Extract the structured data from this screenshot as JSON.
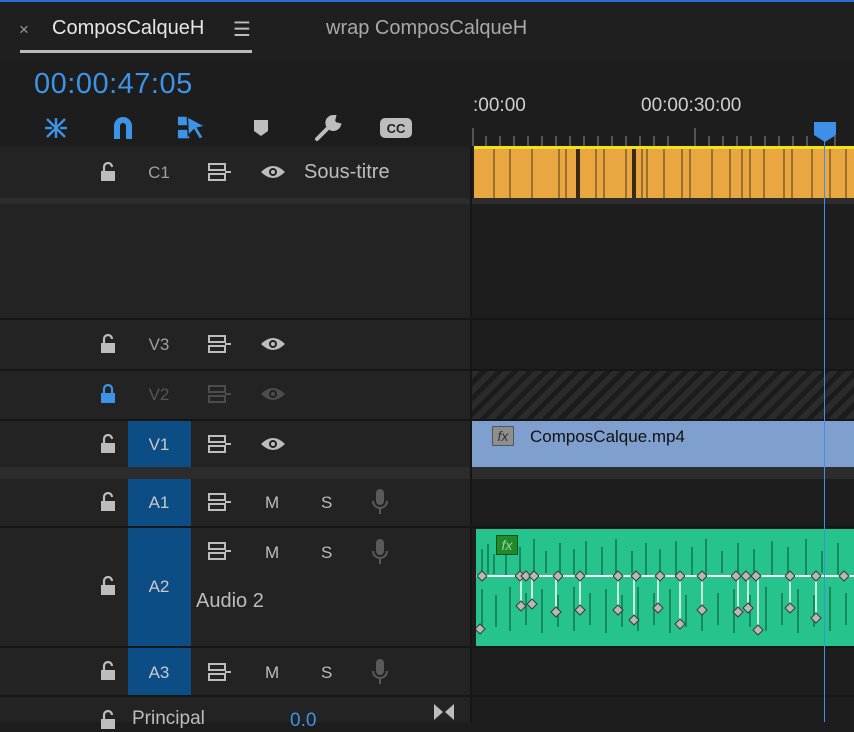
{
  "tabs": [
    {
      "label": "ComposCalqueH",
      "active": true,
      "close_icon": "×",
      "menu_icon": "☰"
    },
    {
      "label": "wrap ComposCalqueH",
      "active": false
    }
  ],
  "timecode": "00:00:47:05",
  "tools": [
    "ripple-icon",
    "snap-magnet-icon",
    "linked-selection-icon",
    "marker-icon",
    "wrench-icon",
    "captions-icon"
  ],
  "tool_labels": {
    "captions": "CC"
  },
  "ruler": {
    "labels": [
      ":00:00",
      "00:00:30:00"
    ]
  },
  "tracks": {
    "c1": {
      "name": "C1",
      "label": "Sous-titre"
    },
    "v3": {
      "name": "V3"
    },
    "v2": {
      "name": "V2",
      "locked": true
    },
    "v1": {
      "name": "V1",
      "clip": "ComposCalque.mp4",
      "fx": "fx"
    },
    "a1": {
      "name": "A1",
      "mute": "M",
      "solo": "S"
    },
    "a2": {
      "name": "A2",
      "label": "Audio 2",
      "mute": "M",
      "solo": "S",
      "fx": "fx"
    },
    "a3": {
      "name": "A3",
      "mute": "M",
      "solo": "S"
    },
    "master": {
      "name": "Principal",
      "value": "0.0"
    }
  },
  "colors": {
    "accent": "#3d94e6",
    "caption_clip": "#e9a641",
    "video_clip": "#7f9fcf",
    "audio_clip": "#27c38c",
    "target": "#0d4d86"
  }
}
